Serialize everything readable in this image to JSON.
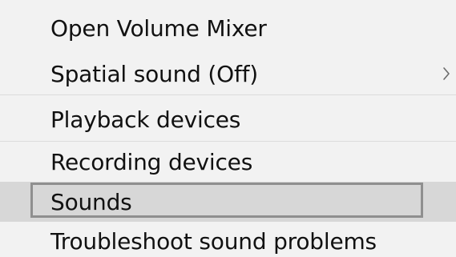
{
  "menu": {
    "items": [
      {
        "label": "Open Volume Mixer"
      },
      {
        "label": "Spatial sound (Off)",
        "submenu_icon": "chevron-right-icon"
      },
      {
        "label": "Playback devices"
      },
      {
        "label": "Recording devices"
      },
      {
        "label": "Sounds",
        "state": "focused"
      },
      {
        "label": "Troubleshoot sound problems"
      }
    ]
  },
  "colors": {
    "background": "#f2f2f2",
    "selected_background": "#d7d7d7",
    "focus_border": "#8f8f8f",
    "text": "#111111",
    "divider": "#dcdcdc"
  }
}
